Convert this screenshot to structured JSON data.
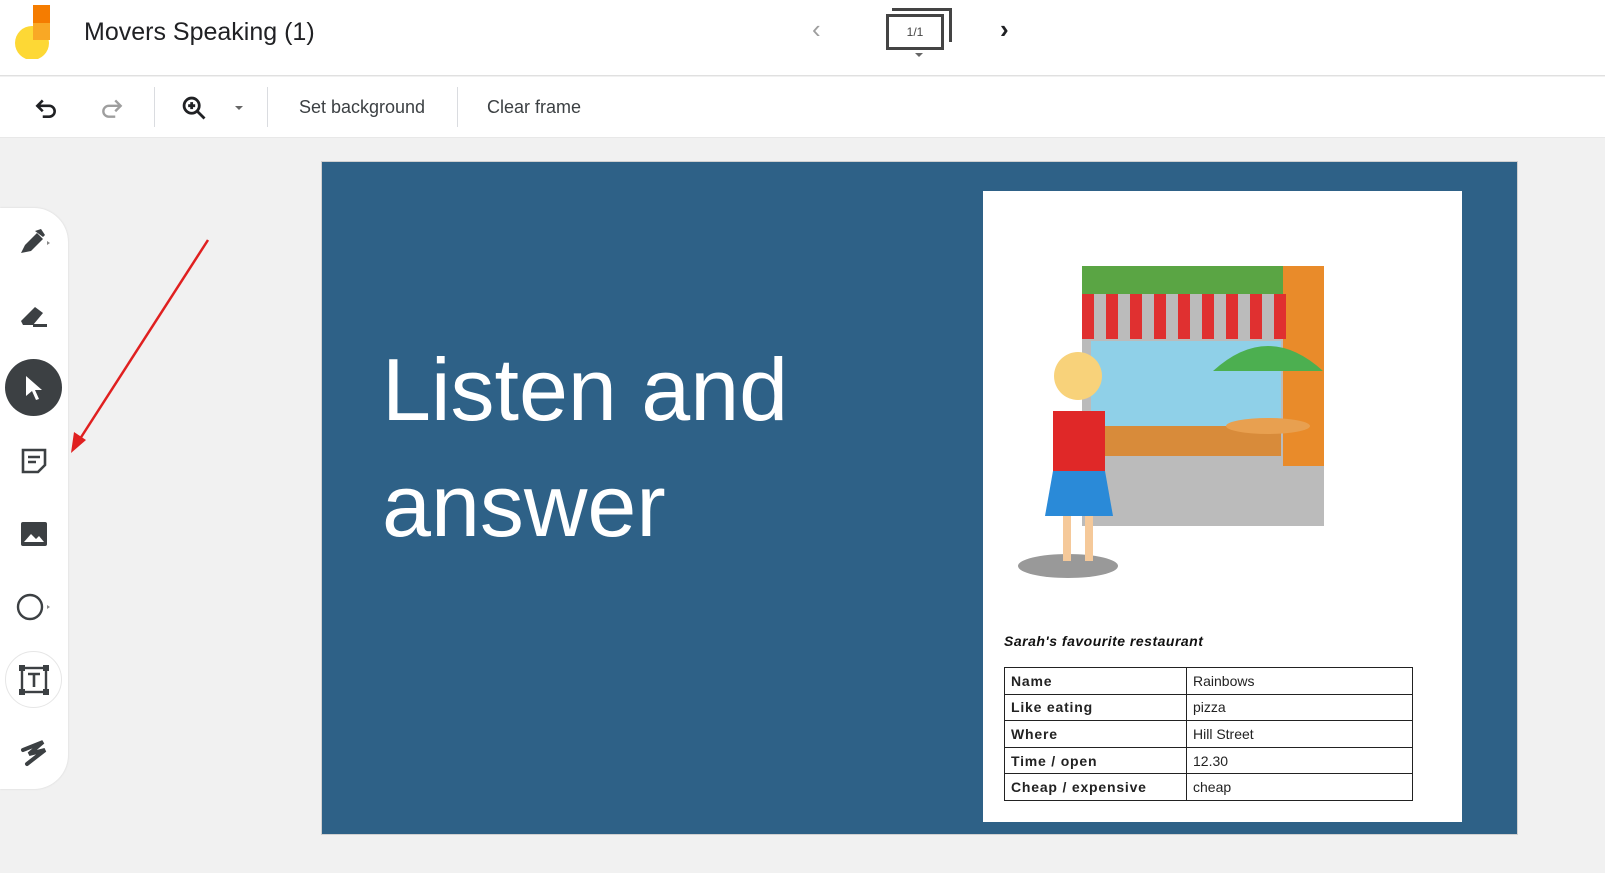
{
  "header": {
    "title": "Movers Speaking (1)",
    "frame_indicator": "1/1"
  },
  "toolbar": {
    "set_background": "Set background",
    "clear_frame": "Clear frame"
  },
  "sidebar": {
    "tools": [
      "pen",
      "eraser",
      "select",
      "sticky-note",
      "image",
      "circle",
      "text-box",
      "laser"
    ]
  },
  "slide": {
    "title_line1": "Listen and",
    "title_line2": "answer",
    "caption": "Sarah's favourite restaurant",
    "table": [
      {
        "key": "Name",
        "value": "Rainbows"
      },
      {
        "key": "Like eating",
        "value": "pizza"
      },
      {
        "key": "Where",
        "value": "Hill Street"
      },
      {
        "key": "Time / open",
        "value": "12.30"
      },
      {
        "key": "Cheap / expensive",
        "value": "cheap"
      }
    ]
  },
  "colors": {
    "frame_bg": "#2e6187",
    "annotation_arrow": "#e02020",
    "active_tool": "#3c4043"
  }
}
